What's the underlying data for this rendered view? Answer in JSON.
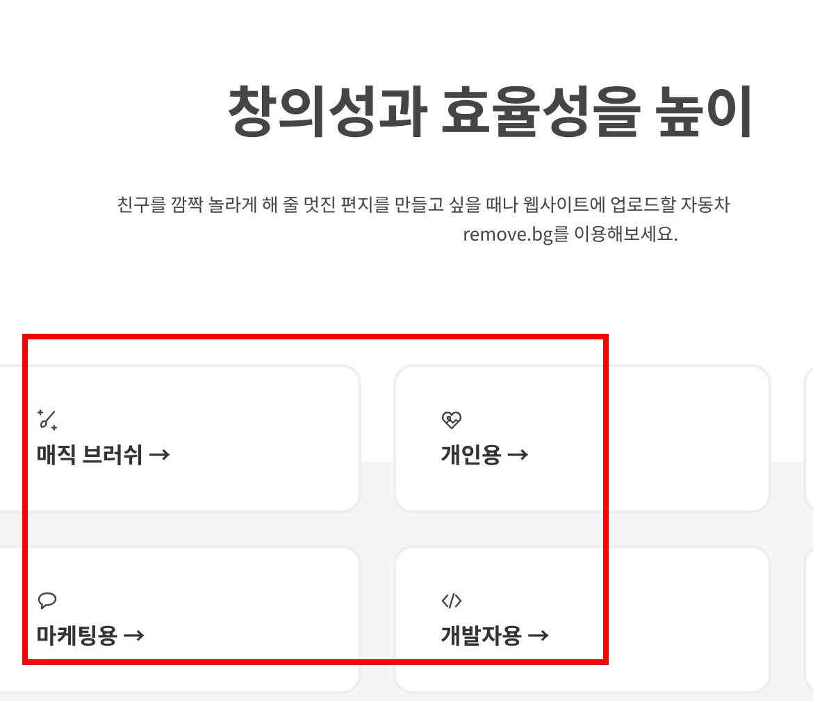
{
  "heading": "창의성과 효율성을 높이",
  "intro": [
    "친구를 깜짝 놀라게 해 줄 멋진 편지를 만들고 싶을 때나 웹사이트에 업로드할 자동차",
    "remove.bg를 이용해보세요."
  ],
  "cards": [
    {
      "kind": "brush",
      "label": "매직 브러쉬 →"
    },
    {
      "kind": "heart",
      "label": "개인용 →"
    },
    {
      "kind": "blank"
    },
    {
      "kind": "chat",
      "label": "마케팅용 →"
    },
    {
      "kind": "code",
      "label": "개발자용 →"
    },
    {
      "kind": "blank"
    }
  ]
}
